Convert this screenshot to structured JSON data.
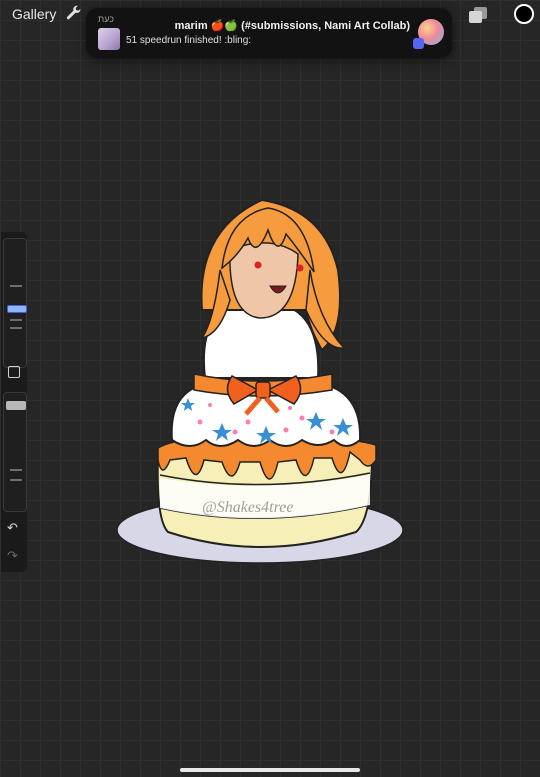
{
  "topbar": {
    "gallery_label": "Gallery"
  },
  "notification": {
    "app_name": "כעת",
    "title": "marim 🍎🍏 (#submissions, Nami Art Collab)",
    "body": "51 speedrun finished! :bling:"
  },
  "artwork": {
    "watermark": "@Shakes4tree"
  },
  "icons": [
    "wrench-icon",
    "layers-icon",
    "color-swatch",
    "square-icon",
    "undo-icon",
    "redo-icon",
    "discord-icon"
  ]
}
